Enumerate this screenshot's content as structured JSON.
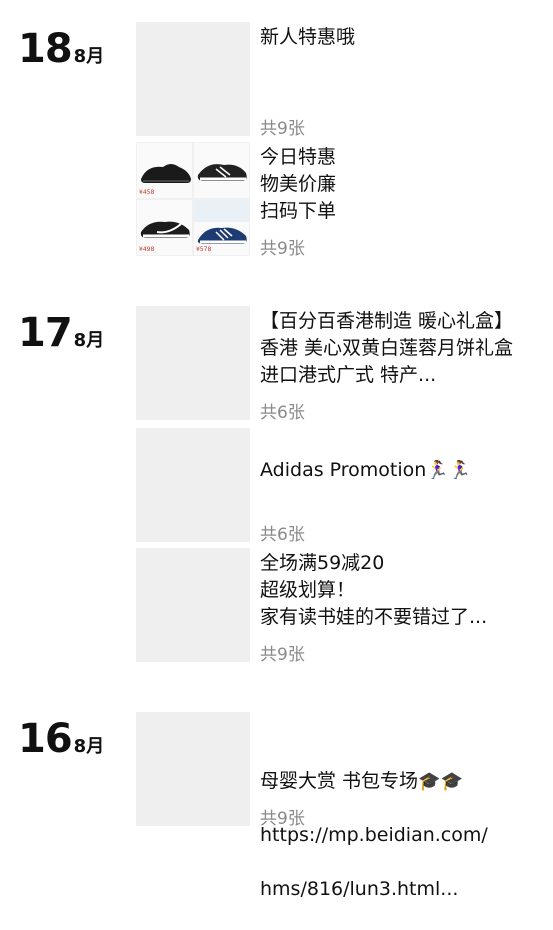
{
  "days": [
    {
      "day": "18",
      "month": "8月",
      "posts": [
        {
          "text": "新人特惠哦",
          "count": "共9张"
        },
        {
          "text": "今日特惠\n物美价廉\n扫码下单",
          "count": "共9张"
        }
      ]
    },
    {
      "day": "17",
      "month": "8月",
      "posts": [
        {
          "text": "【百分百香港制造 暖心礼盒】香港 美心双黄白莲蓉月饼礼盒 进口港式广式 特产...",
          "count": "共6张"
        },
        {
          "text": "Adidas Promotion",
          "emoji": "🏃‍♀️🏃‍♀️",
          "count": "共6张"
        },
        {
          "text": "全场满59减20\n超级划算！\n家有读书娃的不要错过了...",
          "count": "共9张"
        }
      ]
    },
    {
      "day": "16",
      "month": "8月",
      "posts": [
        {
          "text": "母婴大赏 书包专场",
          "emoji": "🎓🎓",
          "link_line1": "https://mp.beidian.com/",
          "link_line2": "hms/816/lun3.html...",
          "count": "共9张"
        }
      ]
    }
  ],
  "shoe_tags": [
    "¥458",
    "¥458",
    "¥498",
    "¥578"
  ],
  "colors": {
    "placeholder": "#efefef",
    "count_text": "#8a8a8a"
  }
}
